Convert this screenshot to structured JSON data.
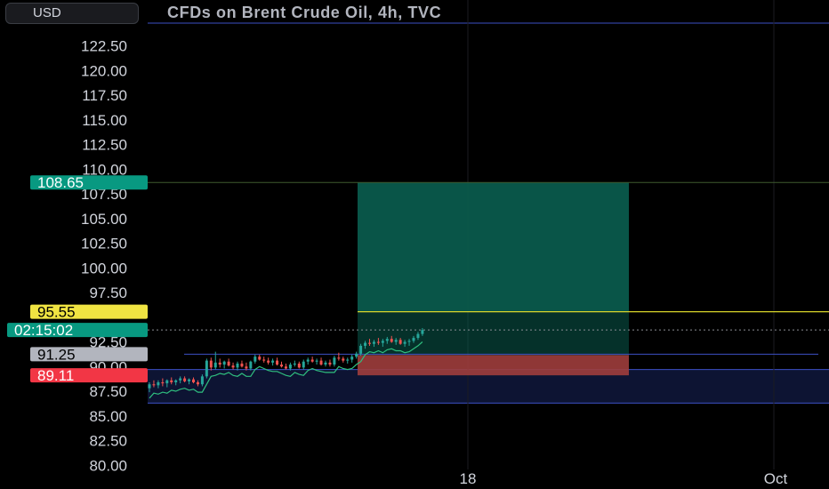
{
  "header": {
    "currency": "USD",
    "title": "CFDs on Brent Crude Oil, 4h, TVC"
  },
  "colors": {
    "background": "#000000",
    "axis_text": "#d1d4dc",
    "candle_up": "#26a69a",
    "candle_down": "#ef5350",
    "profit_zone": "#0a5a4c",
    "loss_zone": "#b23a3a",
    "range_box": "#0d1433",
    "range_line": "#3c4fc4",
    "entry_line": "#d8d52a",
    "trail_line": "#2fbf7f"
  },
  "chart_data": {
    "type": "candlestick",
    "title": "CFDs on Brent Crude Oil, 4h, TVC",
    "currency": "USD",
    "y_ticks": [
      "122.50",
      "120.00",
      "117.50",
      "115.00",
      "112.50",
      "110.00",
      "107.50",
      "105.00",
      "102.50",
      "100.00",
      "97.50",
      "92.50",
      "90.00",
      "87.50",
      "85.00",
      "82.50",
      "80.00"
    ],
    "x_ticks": [
      "18",
      "Oct"
    ],
    "price_labels": [
      {
        "text": "108.65",
        "value": 108.65,
        "role": "target",
        "color": "#089981",
        "text_color": "#ffffff"
      },
      {
        "text": "95.55",
        "value": 95.55,
        "role": "entry",
        "color": "#f0e442",
        "text_color": "#000000"
      },
      {
        "text": "02:15:02",
        "value": 93.7,
        "role": "countdown",
        "color": "#089981",
        "text_color": "#ffffff"
      },
      {
        "text": "91.25",
        "value": 91.25,
        "role": "level",
        "color": "#b2b5be",
        "text_color": "#000000"
      },
      {
        "text": "89.11",
        "value": 89.11,
        "role": "stop",
        "color": "#f23645",
        "text_color": "#ffffff"
      }
    ],
    "levels": {
      "target": 108.65,
      "entry": 95.55,
      "stop": 89.11,
      "current": 93.7,
      "resistance": 91.25,
      "range_top": 89.7,
      "range_bottom": 86.3,
      "top_line": 124.8
    },
    "candles": [
      [
        87.8,
        88.4,
        87.4,
        88.2
      ],
      [
        88.2,
        88.6,
        87.9,
        88.1
      ],
      [
        88.1,
        88.6,
        87.8,
        88.4
      ],
      [
        88.4,
        88.8,
        88.0,
        88.3
      ],
      [
        88.3,
        88.7,
        87.9,
        88.6
      ],
      [
        88.6,
        88.9,
        88.2,
        88.4
      ],
      [
        88.4,
        88.7,
        88.1,
        88.6
      ],
      [
        88.6,
        89.0,
        88.3,
        88.8
      ],
      [
        88.8,
        89.0,
        88.4,
        88.5
      ],
      [
        88.5,
        88.8,
        88.2,
        88.7
      ],
      [
        88.7,
        88.9,
        88.3,
        88.4
      ],
      [
        88.4,
        88.6,
        88.0,
        88.2
      ],
      [
        88.2,
        89.2,
        88.0,
        89.0
      ],
      [
        89.0,
        90.8,
        88.8,
        90.6
      ],
      [
        90.6,
        90.9,
        89.6,
        89.9
      ],
      [
        89.9,
        91.5,
        89.7,
        90.4
      ],
      [
        90.4,
        90.8,
        89.9,
        90.2
      ],
      [
        90.2,
        90.6,
        89.8,
        90.5
      ],
      [
        90.5,
        90.8,
        90.0,
        90.1
      ],
      [
        90.1,
        90.4,
        89.7,
        89.9
      ],
      [
        89.9,
        90.5,
        89.6,
        90.3
      ],
      [
        90.3,
        90.6,
        89.9,
        90.0
      ],
      [
        90.0,
        90.4,
        89.6,
        89.8
      ],
      [
        89.8,
        90.6,
        89.6,
        90.5
      ],
      [
        90.5,
        91.2,
        90.3,
        91.0
      ],
      [
        91.0,
        91.2,
        90.6,
        90.7
      ],
      [
        90.7,
        91.0,
        90.4,
        90.6
      ],
      [
        90.6,
        90.9,
        90.2,
        90.4
      ],
      [
        90.4,
        90.8,
        90.1,
        90.6
      ],
      [
        90.6,
        90.9,
        90.1,
        90.2
      ],
      [
        90.2,
        90.5,
        89.9,
        90.0
      ],
      [
        90.0,
        90.3,
        89.7,
        89.8
      ],
      [
        89.8,
        90.4,
        89.6,
        90.2
      ],
      [
        90.2,
        90.6,
        90.0,
        90.3
      ],
      [
        90.3,
        90.5,
        89.8,
        89.9
      ],
      [
        89.9,
        90.7,
        89.7,
        90.5
      ],
      [
        90.5,
        90.9,
        90.2,
        90.7
      ],
      [
        90.7,
        91.0,
        90.4,
        90.5
      ],
      [
        90.5,
        90.8,
        90.2,
        90.6
      ],
      [
        90.6,
        90.9,
        90.1,
        90.2
      ],
      [
        90.2,
        90.6,
        90.0,
        90.4
      ],
      [
        90.4,
        90.7,
        90.0,
        90.2
      ],
      [
        90.2,
        91.1,
        90.0,
        90.9
      ],
      [
        90.9,
        91.4,
        90.6,
        90.8
      ],
      [
        90.8,
        91.0,
        90.4,
        90.6
      ],
      [
        90.6,
        90.9,
        90.3,
        90.7
      ],
      [
        90.7,
        91.2,
        90.4,
        91.0
      ],
      [
        91.0,
        91.5,
        90.8,
        91.3
      ],
      [
        91.3,
        92.3,
        91.1,
        92.1
      ],
      [
        92.1,
        92.6,
        91.8,
        92.4
      ],
      [
        92.4,
        92.8,
        92.1,
        92.3
      ],
      [
        92.3,
        92.7,
        92.0,
        92.5
      ],
      [
        92.5,
        92.9,
        92.2,
        92.4
      ],
      [
        92.4,
        92.8,
        92.0,
        92.6
      ],
      [
        92.6,
        93.0,
        92.3,
        92.8
      ],
      [
        92.8,
        93.1,
        92.4,
        92.5
      ],
      [
        92.5,
        92.9,
        92.2,
        92.7
      ],
      [
        92.7,
        92.9,
        92.2,
        92.3
      ],
      [
        92.3,
        92.7,
        92.0,
        92.5
      ],
      [
        92.5,
        92.8,
        92.1,
        92.6
      ],
      [
        92.6,
        93.1,
        92.4,
        92.9
      ],
      [
        92.9,
        93.5,
        92.7,
        93.3
      ],
      [
        93.3,
        93.9,
        93.1,
        93.7
      ]
    ]
  }
}
